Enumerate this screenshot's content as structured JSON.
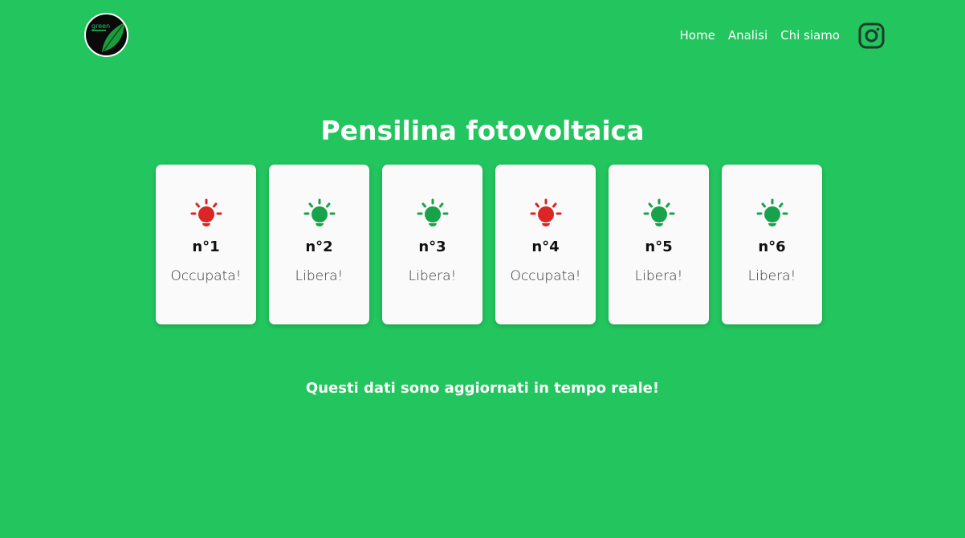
{
  "header": {
    "logo": {
      "text": "green",
      "icon": "leaf-logo"
    },
    "nav": [
      {
        "label": "Home"
      },
      {
        "label": "Analisi"
      },
      {
        "label": "Chi siamo"
      }
    ],
    "social_icon": "instagram-icon"
  },
  "main": {
    "title": "Pensilina fotovoltaica",
    "spots": [
      {
        "number": "n°1",
        "status": "Occupata!",
        "occupied": true
      },
      {
        "number": "n°2",
        "status": "Libera!",
        "occupied": false
      },
      {
        "number": "n°3",
        "status": "Libera!",
        "occupied": false
      },
      {
        "number": "n°4",
        "status": "Occupata!",
        "occupied": true
      },
      {
        "number": "n°5",
        "status": "Libera!",
        "occupied": false
      },
      {
        "number": "n°6",
        "status": "Libera!",
        "occupied": false
      }
    ],
    "note": "Questi dati sono aggiornati in tempo reale!"
  },
  "colors": {
    "background": "#22c55e",
    "occupied": "#dc2626",
    "free": "#16a34a",
    "instagram": "#1f3b2c"
  }
}
